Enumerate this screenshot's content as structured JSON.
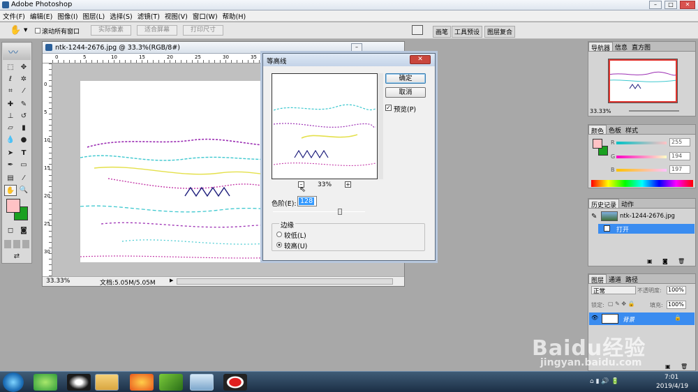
{
  "app": {
    "title": "Adobe Photoshop"
  },
  "menu": [
    "文件(F)",
    "编辑(E)",
    "图像(I)",
    "图层(L)",
    "选择(S)",
    "滤镜(T)",
    "视图(V)",
    "窗口(W)",
    "帮助(H)"
  ],
  "options": {
    "scroll_all": "滚动所有窗口",
    "actual_pixels": "实际像素",
    "fit_screen": "适合屏幕",
    "print_size": "打印尺寸"
  },
  "palette_well": [
    "画笔",
    "工具预设",
    "图层复合"
  ],
  "document": {
    "title": "ntk-1244-2676.jpg @ 33.3%(RGB/8#)",
    "zoom": "33.33%",
    "doc_info": "文档:5.05M/5.05M",
    "hruler": [
      "0",
      "5",
      "10",
      "15",
      "20",
      "25",
      "30",
      "35"
    ],
    "vruler": [
      "0",
      "5",
      "10",
      "15",
      "20",
      "25",
      "30"
    ]
  },
  "dialog": {
    "title": "等高线",
    "ok": "确定",
    "cancel": "取消",
    "preview": "预览(P)",
    "zoom": "33%",
    "level_label": "色阶(E):",
    "level_value": "128",
    "level_fraction": 0.5,
    "edge_group": "边缘",
    "lower": "较低(L)",
    "upper": "较高(U)"
  },
  "navigator": {
    "tabs": [
      "导航器",
      "信息",
      "直方图"
    ],
    "zoom": "33.33%"
  },
  "color": {
    "tabs": [
      "颜色",
      "色板",
      "样式"
    ],
    "r_label": "R",
    "g_label": "G",
    "b_label": "B",
    "r": "255",
    "g": "194",
    "b": "197",
    "fg": "#ffc2c5",
    "bg": "#1aa020"
  },
  "history": {
    "tabs": [
      "历史记录",
      "动作"
    ],
    "snapshot": "ntk-1244-2676.jpg",
    "step": "打开"
  },
  "layers": {
    "tabs": [
      "图层",
      "通道",
      "路径"
    ],
    "mode": "正常",
    "opacity_label": "不透明度:",
    "opacity": "100%",
    "lock_label": "锁定:",
    "fill_label": "填充:",
    "fill": "100%",
    "layer_name": "背景"
  },
  "taskbar": {
    "time": "7:01",
    "date": "2019/4/19"
  },
  "watermark": {
    "logo": "Baidu经验",
    "url": "jingyan.baidu.com"
  }
}
